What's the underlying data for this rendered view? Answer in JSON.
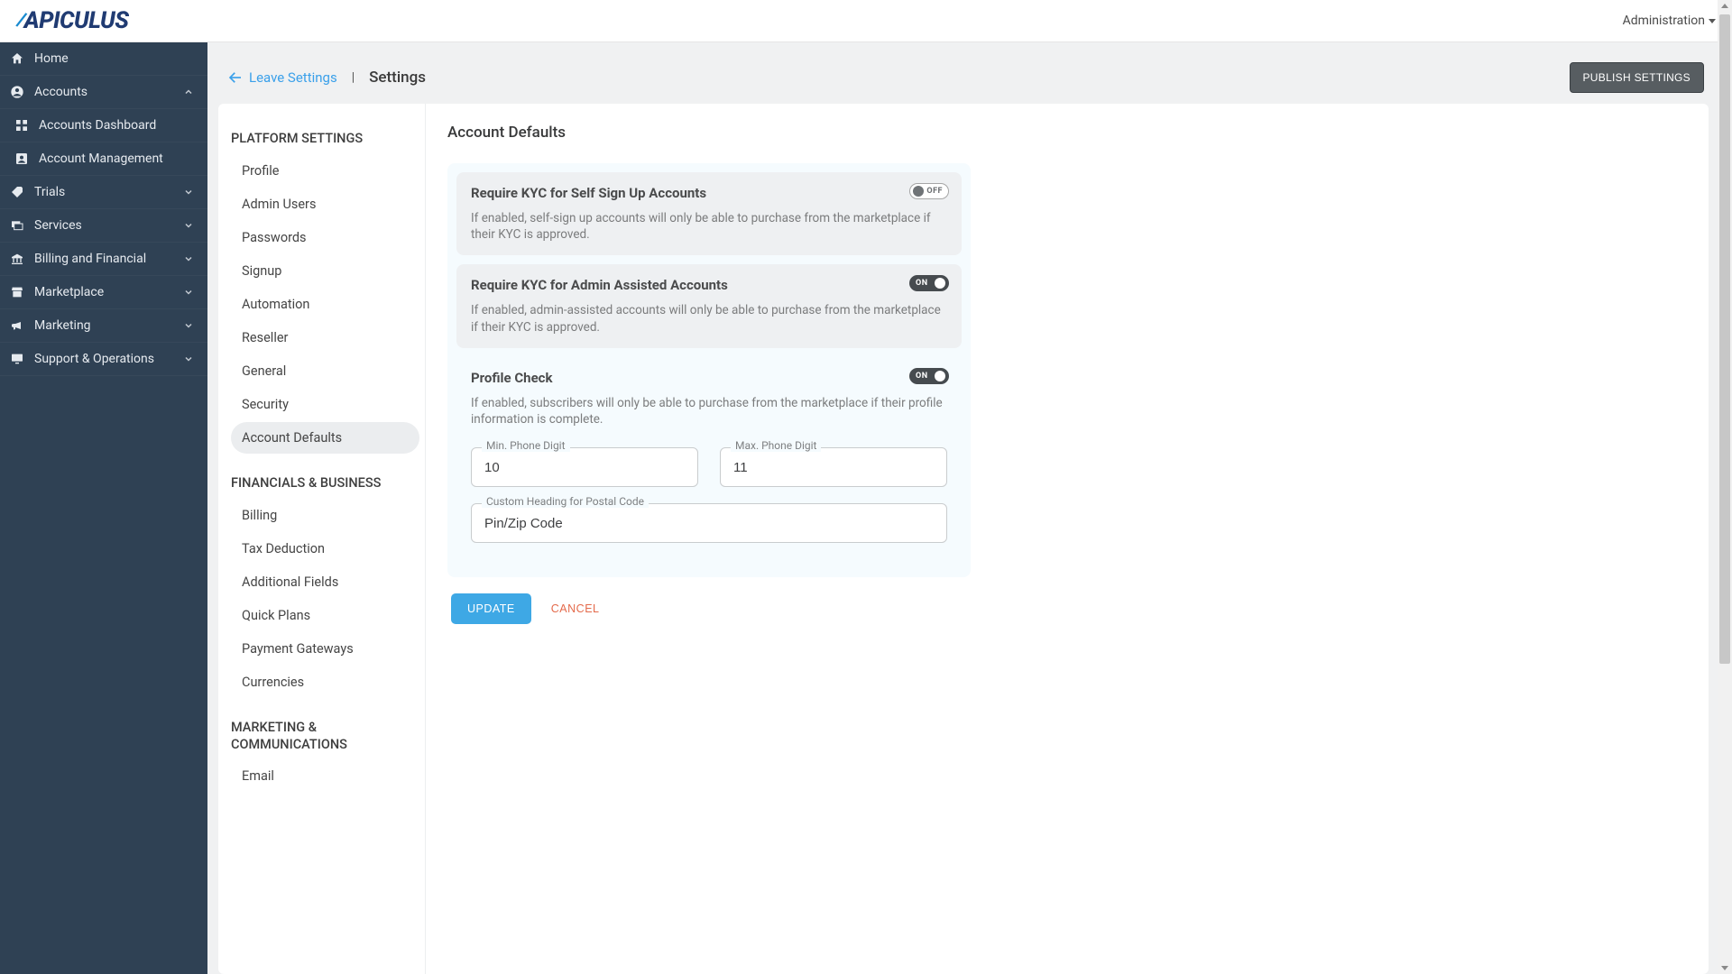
{
  "brand": "APICULUS",
  "header": {
    "admin_label": "Administration"
  },
  "breadcrumb": {
    "leave": "Leave Settings",
    "title": "Settings",
    "publish": "PUBLISH SETTINGS"
  },
  "sidebar": {
    "home": "Home",
    "accounts": "Accounts",
    "accounts_dashboard": "Accounts Dashboard",
    "account_management": "Account Management",
    "trials": "Trials",
    "services": "Services",
    "billing": "Billing and Financial",
    "marketplace": "Marketplace",
    "marketing": "Marketing",
    "support": "Support & Operations"
  },
  "settings_nav": {
    "platform_heading": "PLATFORM SETTINGS",
    "platform_items": [
      "Profile",
      "Admin Users",
      "Passwords",
      "Signup",
      "Automation",
      "Reseller",
      "General",
      "Security",
      "Account Defaults"
    ],
    "fin_heading": "FINANCIALS & BUSINESS",
    "fin_items": [
      "Billing",
      "Tax Deduction",
      "Additional Fields",
      "Quick Plans",
      "Payment Gateways",
      "Currencies"
    ],
    "mkt_heading": "MARKETING & COMMUNICATIONS",
    "mkt_items": [
      "Email"
    ]
  },
  "body": {
    "title": "Account Defaults",
    "toggle_on_text": "ON",
    "toggle_off_text": "OFF",
    "card1": {
      "title": "Require KYC for Self Sign Up Accounts",
      "desc": "If enabled, self-sign up accounts will only be able to purchase from the marketplace if their KYC is approved.",
      "state": "off"
    },
    "card2": {
      "title": "Require KYC for Admin Assisted Accounts",
      "desc": "If enabled, admin-assisted accounts will only be able to purchase from the marketplace if their KYC is approved.",
      "state": "on"
    },
    "card3": {
      "title": "Profile Check",
      "desc": "If enabled, subscribers will only be able to purchase from the marketplace if their profile information is complete.",
      "state": "on",
      "min_phone_label": "Min. Phone Digit",
      "min_phone_value": "10",
      "max_phone_label": "Max. Phone Digit",
      "max_phone_value": "11",
      "postal_label": "Custom Heading for Postal Code",
      "postal_value": "Pin/Zip Code"
    },
    "update": "UPDATE",
    "cancel": "CANCEL"
  }
}
